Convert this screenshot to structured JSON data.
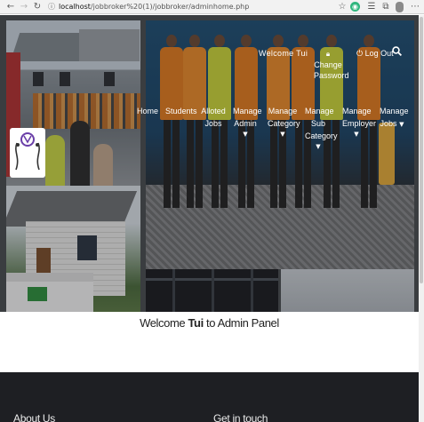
{
  "browser": {
    "url_host": "localhost",
    "url_path": "/jobbroker%20(1)/jobbroker/adminhome.php",
    "icons": [
      "back-arrow-icon",
      "forward-arrow-icon",
      "reload-icon",
      "star-icon",
      "extension-icon",
      "favorites-icon",
      "collections-icon",
      "profile-icon",
      "more-icon"
    ]
  },
  "topnav": {
    "welcome_prefix": "Welcome",
    "welcome_name": "Tui",
    "change_password": "Change Password",
    "logout": "Log Out"
  },
  "mainnav": {
    "home": "Home",
    "students": "Students",
    "alloted_jobs": "Alloted Jobs",
    "manage_admin": "Manage Admin",
    "manage_category": "Manage Category",
    "manage_sub_category": "Manage Sub Category",
    "manage_employer": "Manage Employer",
    "manage_jobs": "Manage Jobs"
  },
  "welcome": {
    "prefix": "Welcome",
    "name": "Tui",
    "suffix": "to Admin Panel"
  },
  "footer": {
    "about": "About Us",
    "contact": "Get in touch"
  },
  "colors": {
    "footer_bg": "#1e1f23",
    "vest_orange": "#e07a1f",
    "vest_yellow": "#c9d33a"
  }
}
